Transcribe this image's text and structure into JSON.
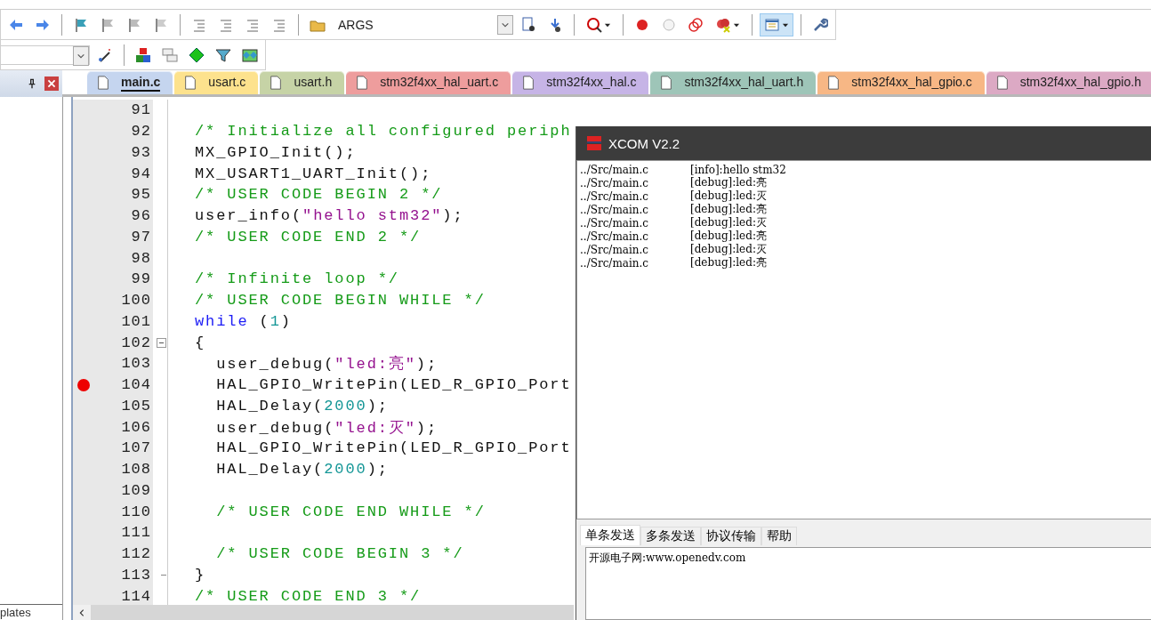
{
  "toolbar": {
    "args_label": "ARGS",
    "window_button_selected": true
  },
  "left_panel": {
    "bottom_tab": "plates"
  },
  "tabs": [
    {
      "label": "main.c",
      "selected": true,
      "color": "#c5d5ef"
    },
    {
      "label": "usart.c",
      "selected": false,
      "color": "#fde28d"
    },
    {
      "label": "usart.h",
      "selected": false,
      "color": "#c6d3a6"
    },
    {
      "label": "stm32f4xx_hal_uart.c",
      "selected": false,
      "color": "#ee9d9d"
    },
    {
      "label": "stm32f4xx_hal.c",
      "selected": false,
      "color": "#c6b4e6"
    },
    {
      "label": "stm32f4xx_hal_uart.h",
      "selected": false,
      "color": "#9ec5b8"
    },
    {
      "label": "stm32f4xx_hal_gpio.c",
      "selected": false,
      "color": "#f7b785"
    },
    {
      "label": "stm32f4xx_hal_gpio.h",
      "selected": false,
      "color": "#dca9c4"
    }
  ],
  "editor": {
    "lines": [
      {
        "number": "91",
        "breakpoint": false,
        "kind": "code"
      },
      {
        "number": "92",
        "breakpoint": false,
        "kind": "code",
        "tokens": [
          {
            "kind": "comment",
            "text": "/* Initialize all configured periph"
          }
        ]
      },
      {
        "number": "93",
        "breakpoint": false,
        "kind": "code",
        "tokens": [
          {
            "kind": "plain",
            "text": "MX_GPIO_Init();"
          }
        ]
      },
      {
        "number": "94",
        "breakpoint": false,
        "kind": "code",
        "tokens": [
          {
            "kind": "plain",
            "text": "MX_USART1_UART_Init();"
          }
        ]
      },
      {
        "number": "95",
        "breakpoint": false,
        "kind": "code",
        "tokens": [
          {
            "kind": "comment",
            "text": "/* USER CODE BEGIN 2 */"
          }
        ]
      },
      {
        "number": "96",
        "breakpoint": false,
        "kind": "code",
        "tokens": [
          {
            "kind": "plain",
            "text": "user_info("
          },
          {
            "kind": "string",
            "text": "\"hello stm32\""
          },
          {
            "kind": "plain",
            "text": ");"
          }
        ]
      },
      {
        "number": "97",
        "breakpoint": false,
        "kind": "code",
        "tokens": [
          {
            "kind": "comment",
            "text": "/* USER CODE END 2 */"
          }
        ]
      },
      {
        "number": "98",
        "breakpoint": false,
        "kind": "code"
      },
      {
        "number": "99",
        "breakpoint": false,
        "kind": "code",
        "tokens": [
          {
            "kind": "comment",
            "text": "/* Infinite loop */"
          }
        ]
      },
      {
        "number": "100",
        "breakpoint": false,
        "kind": "code",
        "tokens": [
          {
            "kind": "comment",
            "text": "/* USER CODE BEGIN WHILE */"
          }
        ]
      },
      {
        "number": "101",
        "breakpoint": false,
        "kind": "code",
        "tokens": [
          {
            "kind": "keyword",
            "text": "while"
          },
          {
            "kind": "plain",
            "text": " ("
          },
          {
            "kind": "number",
            "text": "1"
          },
          {
            "kind": "plain",
            "text": ")"
          }
        ]
      },
      {
        "number": "102",
        "breakpoint": false,
        "kind": "fold_start",
        "tokens": [
          {
            "kind": "plain",
            "text": "{"
          }
        ]
      },
      {
        "number": "103",
        "breakpoint": false,
        "kind": "code",
        "tokens": [
          {
            "kind": "plain",
            "text": "  user_debug("
          },
          {
            "kind": "string",
            "text": "\"led:亮\""
          },
          {
            "kind": "plain",
            "text": ");"
          }
        ]
      },
      {
        "number": "104",
        "breakpoint": true,
        "kind": "code",
        "tokens": [
          {
            "kind": "plain",
            "text": "  HAL_GPIO_WritePin(LED_R_GPIO_Port"
          }
        ]
      },
      {
        "number": "105",
        "breakpoint": false,
        "kind": "code",
        "tokens": [
          {
            "kind": "plain",
            "text": "  HAL_Delay("
          },
          {
            "kind": "number",
            "text": "2000"
          },
          {
            "kind": "plain",
            "text": ");"
          }
        ]
      },
      {
        "number": "106",
        "breakpoint": false,
        "kind": "code",
        "tokens": [
          {
            "kind": "plain",
            "text": "  user_debug("
          },
          {
            "kind": "string",
            "text": "\"led:灭\""
          },
          {
            "kind": "plain",
            "text": ");"
          }
        ]
      },
      {
        "number": "107",
        "breakpoint": false,
        "kind": "code",
        "tokens": [
          {
            "kind": "plain",
            "text": "  HAL_GPIO_WritePin(LED_R_GPIO_Port"
          }
        ]
      },
      {
        "number": "108",
        "breakpoint": false,
        "kind": "code",
        "tokens": [
          {
            "kind": "plain",
            "text": "  HAL_Delay("
          },
          {
            "kind": "number",
            "text": "2000"
          },
          {
            "kind": "plain",
            "text": ");"
          }
        ]
      },
      {
        "number": "109",
        "breakpoint": false,
        "kind": "code"
      },
      {
        "number": "110",
        "breakpoint": false,
        "kind": "code",
        "tokens": [
          {
            "kind": "comment",
            "text": "  /* USER CODE END WHILE */"
          }
        ]
      },
      {
        "number": "111",
        "breakpoint": false,
        "kind": "code"
      },
      {
        "number": "112",
        "breakpoint": false,
        "kind": "code",
        "tokens": [
          {
            "kind": "comment",
            "text": "  /* USER CODE BEGIN 3 */"
          }
        ]
      },
      {
        "number": "113",
        "breakpoint": false,
        "kind": "fold_end",
        "tokens": [
          {
            "kind": "plain",
            "text": "}"
          }
        ]
      },
      {
        "number": "114",
        "breakpoint": false,
        "kind": "code",
        "tokens": [
          {
            "kind": "comment",
            "text": "/* USER CODE END 3 */"
          }
        ]
      }
    ]
  },
  "xcom": {
    "title": "XCOM V2.2",
    "log": [
      {
        "source": "../Src/main.c",
        "message": "[info]:hello stm32"
      },
      {
        "source": "../Src/main.c",
        "message": "[debug]:led:亮"
      },
      {
        "source": "../Src/main.c",
        "message": "[debug]:led:灭"
      },
      {
        "source": "../Src/main.c",
        "message": "[debug]:led:亮"
      },
      {
        "source": "../Src/main.c",
        "message": "[debug]:led:灭"
      },
      {
        "source": "../Src/main.c",
        "message": "[debug]:led:亮"
      },
      {
        "source": "../Src/main.c",
        "message": "[debug]:led:灭"
      },
      {
        "source": "../Src/main.c",
        "message": "[debug]:led:亮"
      }
    ],
    "tabs": [
      {
        "label": "单条发送",
        "selected": true
      },
      {
        "label": "多条发送",
        "selected": false
      },
      {
        "label": "协议传输",
        "selected": false
      },
      {
        "label": "帮助",
        "selected": false
      }
    ],
    "send_text": "开源电子网:www.openedv.com"
  }
}
